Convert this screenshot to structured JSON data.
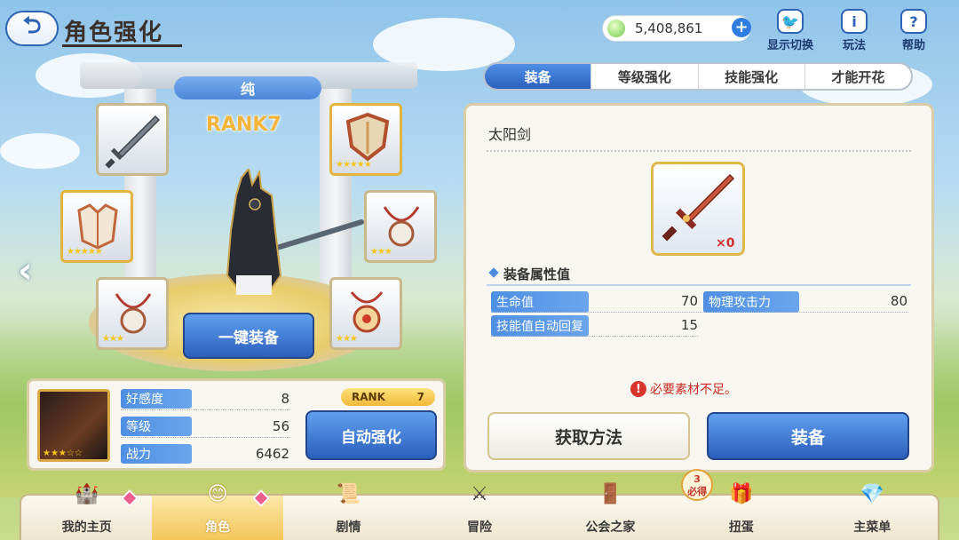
{
  "header": {
    "back_icon": "back-arrow-icon",
    "title": "角色强化",
    "currency_value": "5,408,861",
    "top_buttons": [
      {
        "label": "显示切换",
        "icon": "bird-icon"
      },
      {
        "label": "玩法",
        "icon": "info-icon"
      },
      {
        "label": "帮助",
        "icon": "help-icon"
      }
    ]
  },
  "tabs": [
    {
      "label": "装备",
      "active": true
    },
    {
      "label": "等级强化",
      "active": false
    },
    {
      "label": "技能强化",
      "active": false
    },
    {
      "label": "才能开花",
      "active": false
    }
  ],
  "character": {
    "rarity": "纯",
    "rank": "RANK7",
    "one_click_label": "一键装备"
  },
  "stats_card": {
    "rank_label": "RANK",
    "rank_value": "7",
    "rows": [
      {
        "label": "好感度",
        "value": "8"
      },
      {
        "label": "等级",
        "value": "56"
      },
      {
        "label": "战力",
        "value": "6462"
      }
    ],
    "auto_button": "自动强化"
  },
  "equipment_detail": {
    "name": "太阳剑",
    "quantity": "×0",
    "attr_title": "装备属性值",
    "stats": [
      {
        "label": "生命值",
        "value": "70"
      },
      {
        "label": "物理攻击力",
        "value": "80"
      },
      {
        "label": "技能值自动回复",
        "value": "15"
      }
    ],
    "warning": "必要素材不足。",
    "obtain_button": "获取方法",
    "equip_button": "装备"
  },
  "bottom_nav": [
    {
      "label": "我的主页",
      "icon": "castle-icon"
    },
    {
      "label": "角色",
      "icon": "character-icon",
      "active": true
    },
    {
      "label": "剧情",
      "icon": "scroll-icon"
    },
    {
      "label": "冒险",
      "icon": "sword-flag-icon"
    },
    {
      "label": "公会之家",
      "icon": "door-icon"
    },
    {
      "label": "扭蛋",
      "icon": "gacha-icon",
      "badge": "3",
      "badge_sub": "必得"
    },
    {
      "label": "主菜单",
      "icon": "crystal-icon"
    }
  ],
  "colors": {
    "accent_blue": "#2c5fbd",
    "gold": "#e2b33d",
    "warn_red": "#cc2a22"
  }
}
